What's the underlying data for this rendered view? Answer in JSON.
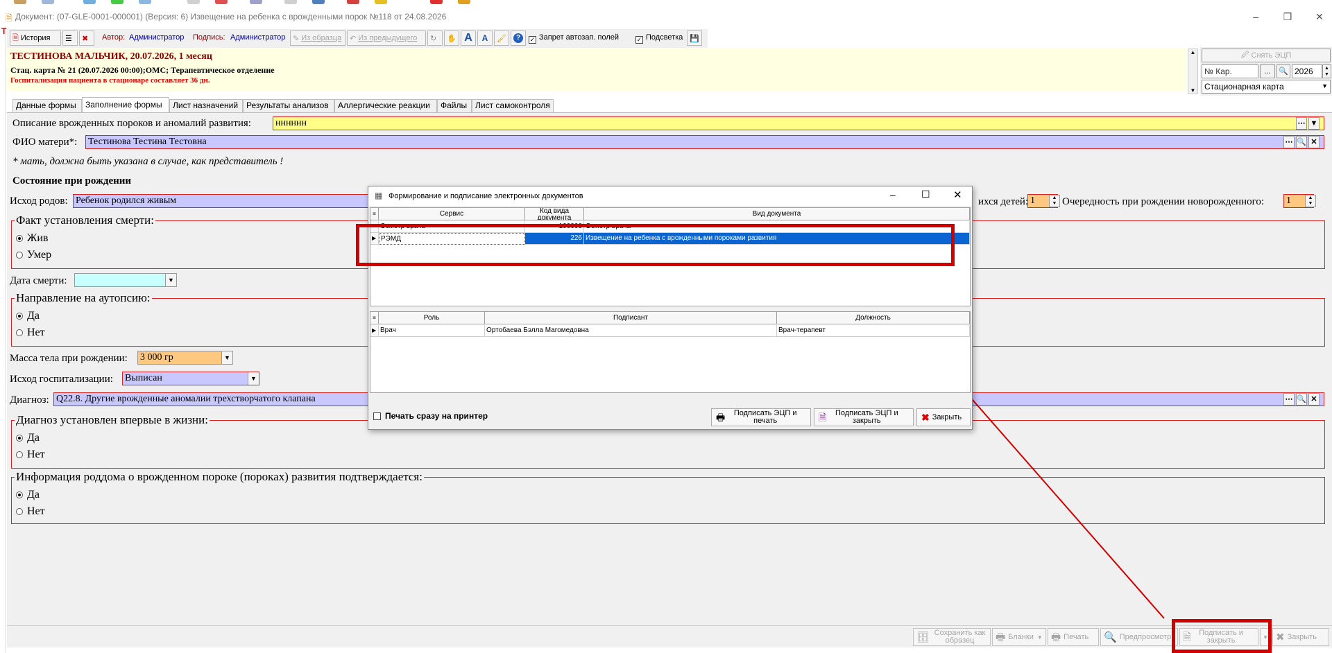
{
  "window": {
    "title": "Документ: (07-GLE-0001-000001) (Версия: 6) Извещение на ребенка с врожденными порок №118 от 24.08.2026"
  },
  "toolbar": {
    "history": "История",
    "author_label": "Автор:",
    "author": "Администратор",
    "signature_label": "Подпись:",
    "signature": "Администратор",
    "from_template": "Из образца",
    "from_previous": "Из предыдущего",
    "font_big": "A",
    "font_small": "A",
    "help": "?",
    "no_autofill": "Запрет автозап. полей",
    "highlight": "Подсветка"
  },
  "patient": {
    "name_line": "ТЕСТИНОВА МАЛЬЧИК, 20.07.2026, 1 месяц",
    "card_line": "Стац. карта  № 21 (20.07.2026 00:00);ОМС; Терапевтическое отделение",
    "stay_line": "Госпитализация пациента в стационаре составляет 36 дн."
  },
  "right_panel": {
    "remove_eds": "Снять ЭЦП",
    "card_no_placeholder": "№ Кар.",
    "dots": "...",
    "year": "2026",
    "card_type": "Стационарная карта"
  },
  "tabs": [
    "Данные формы",
    "Заполнение формы",
    "Лист назначений",
    "Результаты анализов",
    "Аллергические реакции",
    "Файлы",
    "Лист самоконтроля"
  ],
  "form": {
    "malformation_label": "Описание врожденных пороков и аномалий развития:",
    "malformation_value": "нннннн",
    "mother_label": "ФИО матери*:",
    "mother_value": "Тестинова Тестина Тестовна",
    "mother_note": "* мать, должна быть указана в случае, как представитель !",
    "birth_section": "Состояние при рождении",
    "birth_outcome_label": "Исход родов:",
    "birth_outcome_value": "Ребенок родился живым",
    "children_label": "ихся детей:",
    "children_value": "1",
    "order_label": "Очередность при рождении новорожденного:",
    "order_value": "1",
    "death_fact_title": "Факт установления смерти:",
    "alive": "Жив",
    "dead": "Умер",
    "death_date_label": "Дата смерти:",
    "autopsy_title": "Направление на аутопсию:",
    "yes": "Да",
    "no": "Нет",
    "weight_label": "Масса тела при рождении:",
    "weight_value": "3 000 гр",
    "hosp_outcome_label": "Исход госпитализации:",
    "hosp_outcome_value": "Выписан",
    "diagnosis_label": "Диагноз:",
    "diagnosis_value": "Q22.8. Другие врожденные аномалии трехстворчатого клапана",
    "first_time_title": "Диагноз установлен впервые в жизни:",
    "confirmed_title": "Информация роддома о врожденном пороке (пороках) развития подтверждается:"
  },
  "dialog": {
    "title": "Формирование и подписание электронных документов",
    "doc_headers": [
      "Сервис",
      "Код вида документа",
      "Вид документа"
    ],
    "doc_rows": [
      {
        "service": "Осмотр врача",
        "code": "100006",
        "type": "Осмотр врача"
      },
      {
        "service": "РЭМД",
        "code": "226",
        "type": "Извещение на ребенка с врожденными пороками развития"
      }
    ],
    "signer_headers": [
      "Роль",
      "Подписант",
      "Должность"
    ],
    "signer_rows": [
      {
        "role": "Врач",
        "signer": "Ортобаева Бэлла Магомедовна",
        "position": "Врач-терапевт"
      }
    ],
    "print_now": "Печать сразу на принтер",
    "sign_print": "Подписать ЭЦП и печать",
    "sign_close": "Подписать ЭЦП и закрыть",
    "close": "Закрыть"
  },
  "bottom": {
    "save_template": "Сохранить как образец",
    "blanks": "Бланки",
    "print": "Печать",
    "preview": "Предпросмотр",
    "sign_close": "Подписать и закрыть",
    "close": "Закрыть"
  },
  "colors": {
    "annotation_red": "#d00000",
    "selection_blue": "#0a64d2",
    "required_border": "#dd2222"
  }
}
